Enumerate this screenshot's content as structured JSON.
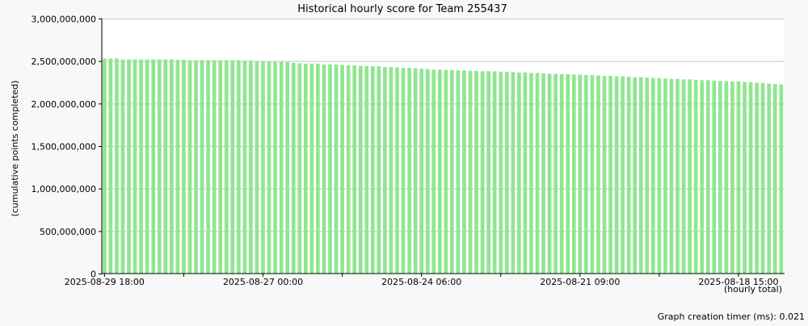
{
  "chart_data": {
    "type": "bar",
    "title": "Historical hourly score for Team 255437",
    "ylabel": "(cumulative points completed)",
    "xlabel": "(hourly total)",
    "ylim": [
      0,
      3000000000
    ],
    "yticks": [
      "0",
      "500,000,000",
      "1,000,000,000",
      "1,500,000,000",
      "2,000,000,000",
      "2,500,000,000",
      "3,000,000,000"
    ],
    "ytick_values": [
      0,
      500000000,
      1000000000,
      1500000000,
      2000000000,
      2500000000,
      3000000000
    ],
    "xtick_labels": [
      {
        "label": "2025-08-29 18:00",
        "bar_index": 0
      },
      {
        "label": "2025-08-27 00:00",
        "bar_index": 26
      },
      {
        "label": "2025-08-24 06:00",
        "bar_index": 52
      },
      {
        "label": "2025-08-21 09:00",
        "bar_index": 78
      },
      {
        "label": "2025-08-18 15:00",
        "bar_index": 104
      }
    ],
    "bar_color": "#90e690",
    "grid": true,
    "values": [
      2530000000,
      2530000000,
      2530000000,
      2520000000,
      2520000000,
      2520000000,
      2520000000,
      2520000000,
      2520000000,
      2520000000,
      2520000000,
      2520000000,
      2515000000,
      2515000000,
      2510000000,
      2510000000,
      2510000000,
      2510000000,
      2510000000,
      2510000000,
      2510000000,
      2510000000,
      2510000000,
      2505000000,
      2505000000,
      2500000000,
      2495000000,
      2495000000,
      2490000000,
      2490000000,
      2490000000,
      2480000000,
      2475000000,
      2470000000,
      2470000000,
      2470000000,
      2460000000,
      2460000000,
      2460000000,
      2455000000,
      2450000000,
      2450000000,
      2445000000,
      2440000000,
      2440000000,
      2440000000,
      2430000000,
      2430000000,
      2425000000,
      2420000000,
      2420000000,
      2415000000,
      2410000000,
      2405000000,
      2400000000,
      2400000000,
      2395000000,
      2395000000,
      2390000000,
      2390000000,
      2385000000,
      2385000000,
      2380000000,
      2380000000,
      2380000000,
      2375000000,
      2375000000,
      2370000000,
      2365000000,
      2365000000,
      2360000000,
      2360000000,
      2355000000,
      2350000000,
      2350000000,
      2345000000,
      2345000000,
      2340000000,
      2340000000,
      2335000000,
      2335000000,
      2330000000,
      2325000000,
      2325000000,
      2320000000,
      2320000000,
      2315000000,
      2310000000,
      2310000000,
      2305000000,
      2300000000,
      2300000000,
      2295000000,
      2290000000,
      2290000000,
      2285000000,
      2285000000,
      2280000000,
      2275000000,
      2275000000,
      2270000000,
      2265000000,
      2265000000,
      2260000000,
      2260000000,
      2255000000,
      2250000000,
      2245000000,
      2240000000,
      2235000000,
      2230000000,
      2225000000
    ]
  },
  "footer": {
    "timer_label": "Graph creation timer (ms): 0.021"
  }
}
